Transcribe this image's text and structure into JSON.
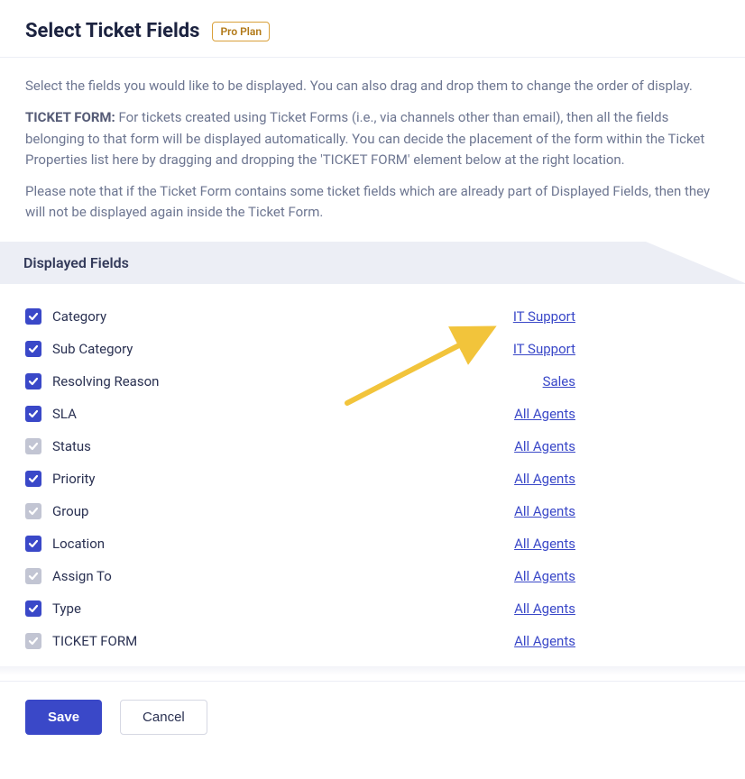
{
  "header": {
    "title": "Select Ticket Fields",
    "badge": "Pro Plan"
  },
  "intro": {
    "p1": "Select the fields you would like to be displayed. You can also drag and drop them to change the order of display.",
    "strong": "TICKET FORM:",
    "p2": " For tickets created using Ticket Forms (i.e., via channels other than email), then all the fields belonging to that form will be displayed automatically. You can decide the placement of the form within the Ticket Properties list here by dragging and dropping the 'TICKET FORM' element below at the right location.",
    "p3": "Please note that if the Ticket Form contains some ticket fields which are already part of Displayed Fields, then they will not be displayed again inside the Ticket Form."
  },
  "section_title": "Displayed Fields",
  "fields": [
    {
      "label": "Category",
      "scope": "IT Support",
      "locked": false
    },
    {
      "label": "Sub Category",
      "scope": "IT Support",
      "locked": false
    },
    {
      "label": "Resolving Reason",
      "scope": "Sales",
      "locked": false
    },
    {
      "label": "SLA",
      "scope": "All Agents",
      "locked": false
    },
    {
      "label": "Status",
      "scope": "All Agents",
      "locked": true
    },
    {
      "label": "Priority",
      "scope": "All Agents",
      "locked": false
    },
    {
      "label": "Group",
      "scope": "All Agents",
      "locked": true
    },
    {
      "label": "Location",
      "scope": "All Agents",
      "locked": false
    },
    {
      "label": "Assign To",
      "scope": "All Agents",
      "locked": true
    },
    {
      "label": "Type",
      "scope": "All Agents",
      "locked": false
    },
    {
      "label": "TICKET FORM",
      "scope": "All Agents",
      "locked": true
    }
  ],
  "footer": {
    "save": "Save",
    "cancel": "Cancel"
  },
  "annotation": {
    "arrow_color": "#f2c43b"
  }
}
